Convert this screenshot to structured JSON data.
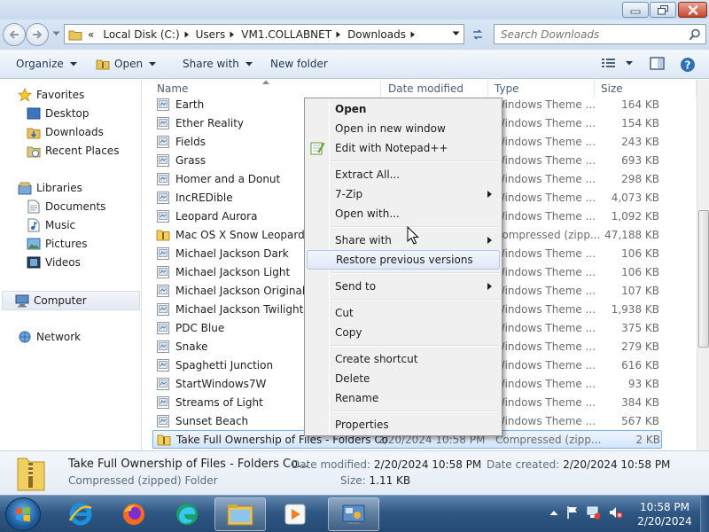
{
  "window": {
    "controls": {
      "minimize": "minimize",
      "maximize": "maximize",
      "close": "close"
    }
  },
  "address": {
    "prefix": "«",
    "crumbs": [
      "Local Disk (C:)",
      "Users",
      "VM1.COLLABNET",
      "Downloads"
    ]
  },
  "search": {
    "placeholder": "Search Downloads"
  },
  "toolbar": {
    "organize": "Organize",
    "open": "Open",
    "share_with": "Share with",
    "new_folder": "New folder"
  },
  "nav": {
    "favorites": "Favorites",
    "desktop": "Desktop",
    "downloads": "Downloads",
    "recent_places": "Recent Places",
    "libraries": "Libraries",
    "documents": "Documents",
    "music": "Music",
    "pictures": "Pictures",
    "videos": "Videos",
    "computer": "Computer",
    "network": "Network"
  },
  "columns": {
    "name": "Name",
    "date": "Date modified",
    "type": "Type",
    "size": "Size"
  },
  "files": [
    {
      "name": "Earth",
      "date": "",
      "type": "Windows Theme ...",
      "size": "164 KB",
      "icon": "theme-file-icon"
    },
    {
      "name": "Ether Reality",
      "date": "",
      "type": "Windows Theme ...",
      "size": "154 KB",
      "icon": "theme-file-icon"
    },
    {
      "name": "Fields",
      "date": "",
      "type": "Windows Theme ...",
      "size": "243 KB",
      "icon": "theme-file-icon"
    },
    {
      "name": "Grass",
      "date": "",
      "type": "Windows Theme ...",
      "size": "693 KB",
      "icon": "theme-file-icon"
    },
    {
      "name": "Homer and a Donut",
      "date": "",
      "type": "Windows Theme ...",
      "size": "298 KB",
      "icon": "theme-file-icon"
    },
    {
      "name": "IncREDible",
      "date": "",
      "type": "Windows Theme ...",
      "size": "4,073 KB",
      "icon": "theme-file-icon"
    },
    {
      "name": "Leopard Aurora",
      "date": "",
      "type": "Windows Theme ...",
      "size": "1,092 KB",
      "icon": "theme-file-icon"
    },
    {
      "name": "Mac OS X Snow Leopard for",
      "date": "",
      "type": "Compressed (zipp...",
      "size": "47,188 KB",
      "icon": "zip-folder-icon"
    },
    {
      "name": "Michael Jackson Dark",
      "date": "",
      "type": "Windows Theme ...",
      "size": "106 KB",
      "icon": "theme-file-icon"
    },
    {
      "name": "Michael Jackson Light",
      "date": "",
      "type": "Windows Theme ...",
      "size": "106 KB",
      "icon": "theme-file-icon"
    },
    {
      "name": "Michael Jackson Original",
      "date": "",
      "type": "Windows Theme ...",
      "size": "107 KB",
      "icon": "theme-file-icon"
    },
    {
      "name": "Michael Jackson Twilight",
      "date": "",
      "type": "Windows Theme ...",
      "size": "1,938 KB",
      "icon": "theme-file-icon"
    },
    {
      "name": "PDC Blue",
      "date": "",
      "type": "Windows Theme ...",
      "size": "375 KB",
      "icon": "theme-file-icon"
    },
    {
      "name": "Snake",
      "date": "",
      "type": "Windows Theme ...",
      "size": "279 KB",
      "icon": "theme-file-icon"
    },
    {
      "name": "Spaghetti Junction",
      "date": "",
      "type": "Windows Theme ...",
      "size": "616 KB",
      "icon": "theme-file-icon"
    },
    {
      "name": "StartWindows7W",
      "date": "",
      "type": "Windows Theme ...",
      "size": "93 KB",
      "icon": "theme-file-icon"
    },
    {
      "name": "Streams of Light",
      "date": "",
      "type": "Windows Theme ...",
      "size": "384 KB",
      "icon": "theme-file-icon"
    },
    {
      "name": "Sunset Beach",
      "date": "",
      "type": "Windows Theme ...",
      "size": "567 KB",
      "icon": "theme-file-icon"
    },
    {
      "name": "Take Full Ownership of Files - Folders Co...",
      "date": "2/20/2024 10:58 PM",
      "type": "Compressed (zipp...",
      "size": "2 KB",
      "icon": "zip-folder-icon",
      "selected": true
    }
  ],
  "context_menu": {
    "items": [
      {
        "label": "Open",
        "bold": true
      },
      {
        "label": "Open in new window"
      },
      {
        "label": "Edit with Notepad++",
        "icon": "notepadpp-icon"
      },
      {
        "separator": true
      },
      {
        "label": "Extract All..."
      },
      {
        "label": "7-Zip",
        "submenu": true
      },
      {
        "label": "Open with..."
      },
      {
        "separator": true
      },
      {
        "label": "Share with",
        "submenu": true
      },
      {
        "label": "Restore previous versions",
        "hover": true
      },
      {
        "separator": true
      },
      {
        "label": "Send to",
        "submenu": true
      },
      {
        "separator": true
      },
      {
        "label": "Cut"
      },
      {
        "label": "Copy"
      },
      {
        "separator": true
      },
      {
        "label": "Create shortcut"
      },
      {
        "label": "Delete"
      },
      {
        "label": "Rename"
      },
      {
        "separator": true
      },
      {
        "label": "Properties"
      }
    ]
  },
  "details": {
    "name": "Take Full Ownership of Files - Folders Co...",
    "type": "Compressed (zipped) Folder",
    "date_modified_label": "Date modified:",
    "date_modified": "2/20/2024 10:58 PM",
    "date_created_label": "Date created:",
    "date_created": "2/20/2024 10:58 PM",
    "size_label": "Size:",
    "size": "1.11 KB"
  },
  "taskbar": {
    "apps": [
      "internet-explorer-icon",
      "firefox-icon",
      "edge-icon",
      "windows-explorer-icon",
      "media-player-icon",
      "control-panel-icon"
    ],
    "time": "10:58 PM",
    "date": "2/20/2024"
  },
  "colors": {
    "accent": "#84acdd",
    "taskbar": "#2f5884",
    "close": "#c7462c"
  }
}
